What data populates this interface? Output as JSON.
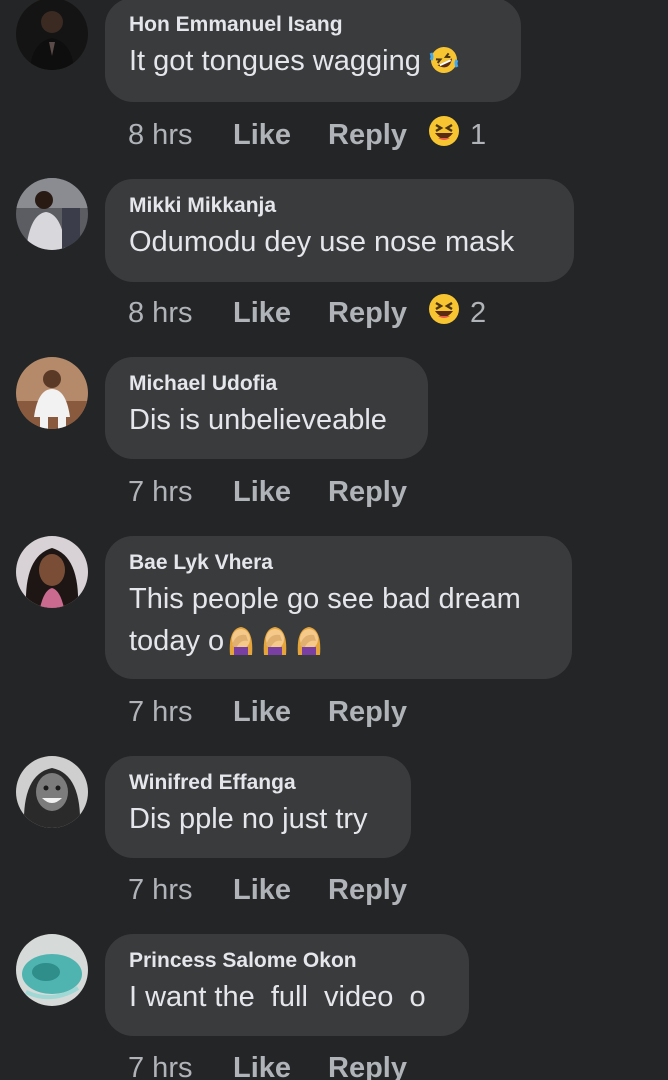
{
  "comments": [
    {
      "author": "Hon Emmanuel Isang",
      "text": "It got tongues wagging",
      "text_emoji_icons": [
        "rofl-emoji-icon"
      ],
      "time": "8 hrs",
      "like_label": "Like",
      "reply_label": "Reply",
      "reaction_icon": "laughing-emoji-icon",
      "reaction_count": "1"
    },
    {
      "author": "Mikki Mikkanja",
      "text": "Odumodu dey use nose mask",
      "time": "8 hrs",
      "like_label": "Like",
      "reply_label": "Reply",
      "reaction_icon": "laughing-emoji-icon",
      "reaction_count": "2"
    },
    {
      "author": "Michael Udofia",
      "text": "Dis is unbelieveable",
      "time": "7 hrs",
      "like_label": "Like",
      "reply_label": "Reply"
    },
    {
      "author": "Bae Lyk Vhera",
      "text_line1": "This people go see bad dream",
      "text_line2": "today o",
      "text_emoji_icons": [
        "facepalm-emoji-icon",
        "facepalm-emoji-icon",
        "facepalm-emoji-icon"
      ],
      "time": "7 hrs",
      "like_label": "Like",
      "reply_label": "Reply"
    },
    {
      "author": "Winifred Effanga",
      "text": "Dis pple no just try",
      "time": "7 hrs",
      "like_label": "Like",
      "reply_label": "Reply"
    },
    {
      "author": "Princess Salome Okon",
      "text": "I want the  full  video  o",
      "time": "7 hrs",
      "like_label": "Like",
      "reply_label": "Reply"
    }
  ],
  "colors": {
    "background": "#242526",
    "bubble": "#3a3b3c",
    "primary_text": "#e4e6eb",
    "secondary_text": "#b0b3b8",
    "emoji_yellow": "#f7c531"
  }
}
